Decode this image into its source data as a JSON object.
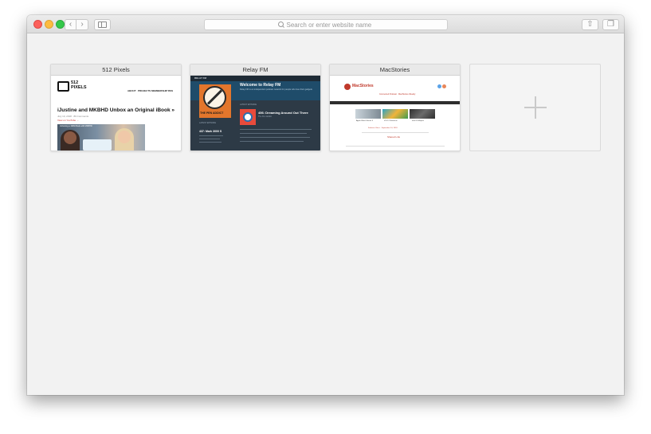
{
  "toolbar": {
    "back_glyph": "‹",
    "forward_glyph": "›",
    "share_glyph": "⇧",
    "tabs_glyph": "❐",
    "search_placeholder": "Search or enter website name",
    "traffic_lights": {
      "close": "#fc605b",
      "minimize": "#fdbc40",
      "zoom": "#34c84a"
    }
  },
  "icons": {
    "back": "chevron-left-icon",
    "forward": "chevron-right-icon",
    "sidebar": "sidebar-icon",
    "search": "search-icon",
    "share": "share-icon",
    "tabs": "tabs-icon",
    "add": "plus-icon"
  },
  "favorites": [
    {
      "title": "512 Pixels",
      "preview": {
        "logo_text": "512\nPIXELS",
        "nav": [
          "ABOUT",
          "PROJECTS",
          "MEMBERSHIP",
          "RSS"
        ],
        "headline": "iJustine and MKBHD Unbox an Original iBook »",
        "meta": "July 10, 2018 · 89 Comments",
        "link": "View on YouTube →",
        "video_caption": "Unboxing a 1999 iBook with MKBHD"
      }
    },
    {
      "title": "Relay FM",
      "preview": {
        "logo": "RELAY FM",
        "welcome": "Welcome to Relay FM",
        "subtitle": "Relay FM is an independent podcast network for people who love their gadgets",
        "art_caption": "THE PEN ADDICT",
        "latest_label": "LATEST EPISODE",
        "episode_title": "456: Dreaming Around Out There",
        "episode_sub": "The Pen Addict",
        "left_heading": "LATEST EPISODE",
        "left_title": "437: Mark 3000 S"
      }
    },
    {
      "title": "MacStories",
      "preview": {
        "logo": "MacStories",
        "promo": "Connected Podcast · MacStories Weekly",
        "captions": [
          "Apple Watch Series 4",
          "iOS 12 Shortcuts",
          "macOS Mojave"
        ],
        "credit": "Federico Viticci · September 14, 2018",
        "author": "Shared Link"
      }
    }
  ],
  "add_tile": {
    "label": ""
  }
}
